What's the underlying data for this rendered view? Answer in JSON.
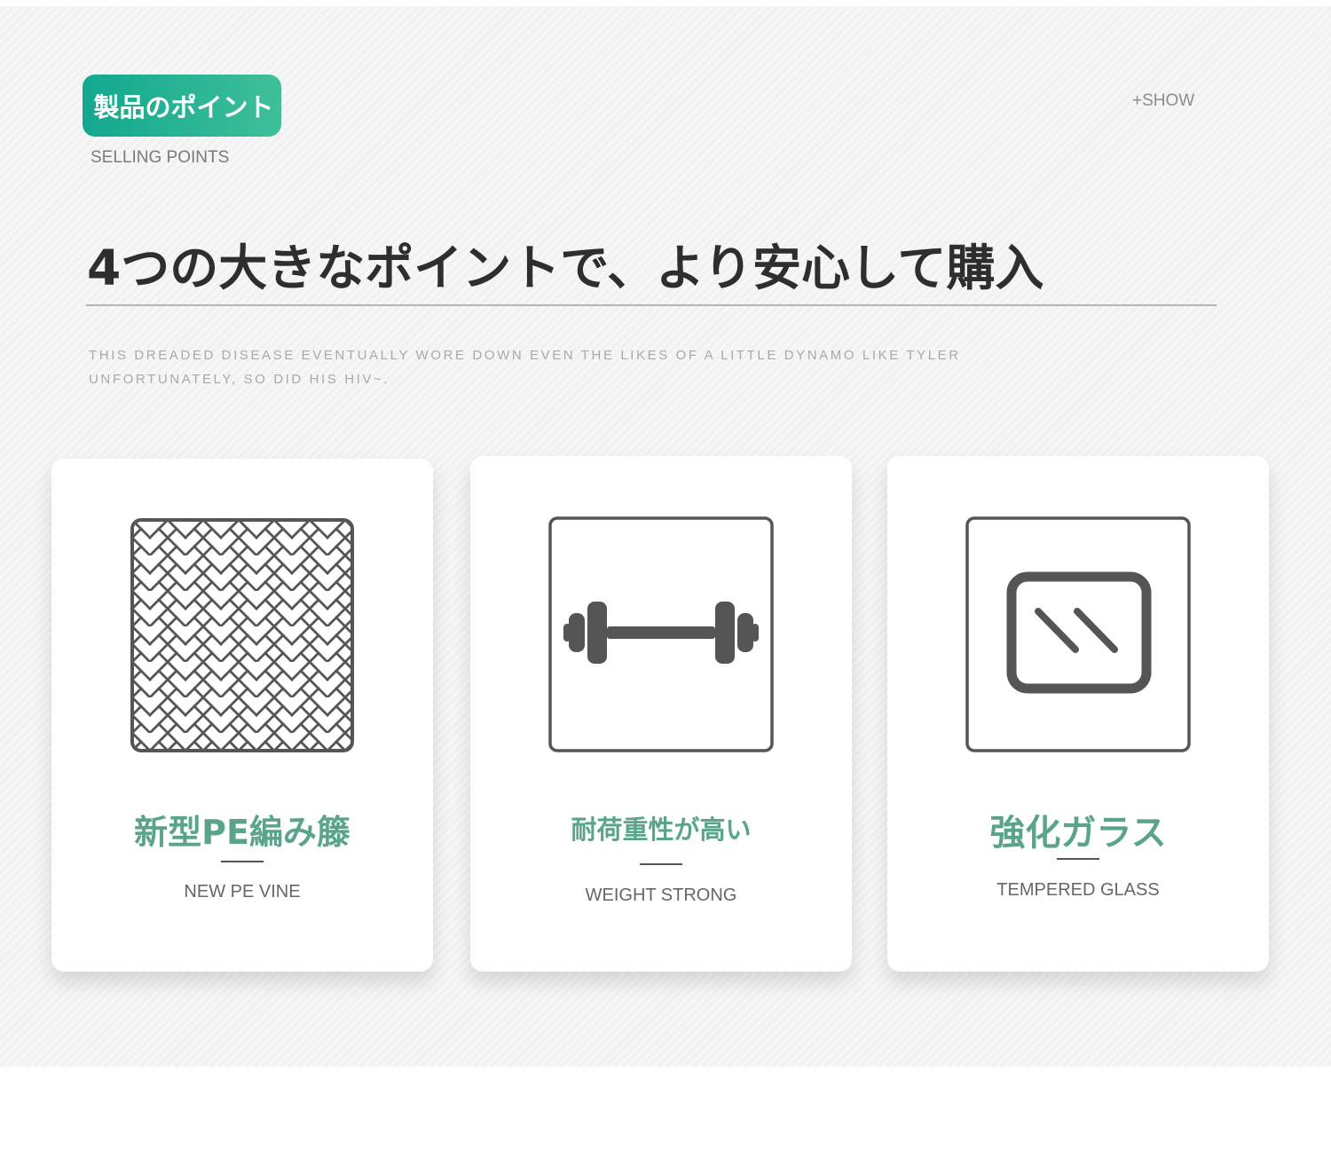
{
  "header": {
    "badge_label": "製品のポイント",
    "eyebrow": "SELLING POINTS",
    "show_link": "+SHOW",
    "headline": "4つの大きなポイントで、より安心して購入",
    "description_lines": [
      "THIS DREADED DISEASE EVENTUALLY WORE DOWN EVEN THE LIKES OF A LITTLE DYNAMO LIKE TYLER",
      "UNFORTUNATELY, SO DID HIS HIV~."
    ]
  },
  "cards": [
    {
      "icon": "rattan-weave-icon",
      "title": "新型PE編み籐",
      "subtitle": "NEW PE VINE"
    },
    {
      "icon": "dumbbell-icon",
      "title": "耐荷重性が高い",
      "subtitle": "WEIGHT STRONG"
    },
    {
      "icon": "glass-panel-icon",
      "title": "強化ガラス",
      "subtitle": "TEMPERED GLASS"
    }
  ],
  "colors": {
    "badge_start": "#12a88f",
    "badge_end": "#3fbf99",
    "card_title": "#5aa58a",
    "headline": "#2e2e2e",
    "icon_stroke": "#555555"
  }
}
